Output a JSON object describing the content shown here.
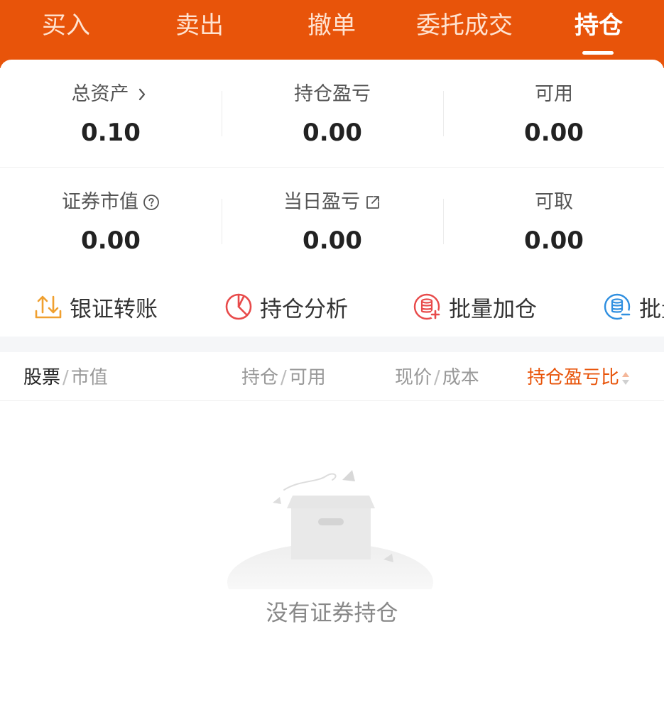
{
  "tabs": [
    {
      "label": "买入"
    },
    {
      "label": "卖出"
    },
    {
      "label": "撤单"
    },
    {
      "label": "委托成交"
    },
    {
      "label": "持仓",
      "active": true
    }
  ],
  "summary": {
    "total_assets": {
      "label": "总资产",
      "value": "0.10"
    },
    "position_pnl": {
      "label": "持仓盈亏",
      "value": "0.00"
    },
    "available": {
      "label": "可用",
      "value": "0.00"
    },
    "securities_value": {
      "label": "证券市值",
      "value": "0.00"
    },
    "daily_pnl": {
      "label": "当日盈亏",
      "value": "0.00"
    },
    "withdrawable": {
      "label": "可取",
      "value": "0.00"
    }
  },
  "actions": [
    {
      "label": "银证转账",
      "icon": "bank-transfer-icon",
      "color": "#F0A030"
    },
    {
      "label": "持仓分析",
      "icon": "pie-chart-icon",
      "color": "#E84A4A"
    },
    {
      "label": "批量加仓",
      "icon": "batch-add-icon",
      "color": "#E84A4A"
    },
    {
      "label": "批量",
      "icon": "batch-reduce-icon",
      "color": "#2F8FE0"
    }
  ],
  "table_header": {
    "stock": "股票",
    "market_value": "市值",
    "position": "持仓",
    "available": "可用",
    "price": "现价",
    "cost": "成本",
    "pnl_ratio": "持仓盈亏比",
    "separator": "/"
  },
  "empty_state": {
    "message": "没有证券持仓"
  },
  "colors": {
    "brand": "#E8540A",
    "active_sort": "#E8540A"
  }
}
